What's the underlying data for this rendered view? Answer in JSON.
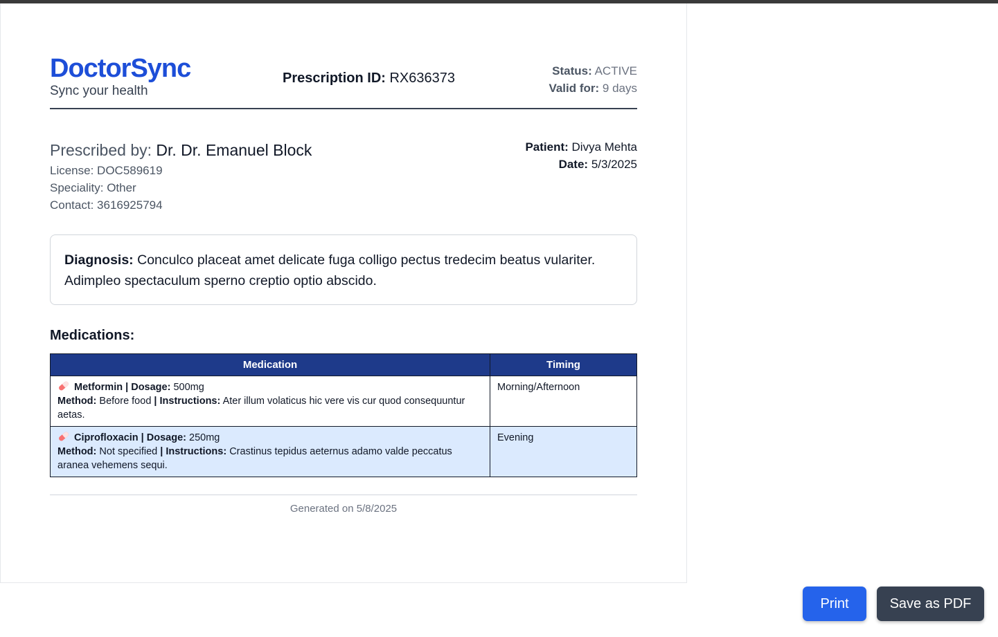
{
  "brand": {
    "name": "DoctorSync",
    "tagline": "Sync your health",
    "color": "#1d4ed8"
  },
  "prescription": {
    "id_label": "Prescription ID:",
    "id": "RX636373",
    "status_label": "Status:",
    "status": "ACTIVE",
    "valid_label": "Valid for:",
    "valid": "9 days"
  },
  "doctor": {
    "prescribed_label": "Prescribed by:",
    "name": "Dr. Dr. Emanuel Block",
    "license": "License: DOC589619",
    "speciality": "Speciality: Other",
    "contact": "Contact: 3616925794"
  },
  "patient": {
    "patient_label": "Patient:",
    "name": "Divya Mehta",
    "date_label": "Date:",
    "date": "5/3/2025"
  },
  "diagnosis": {
    "label": "Diagnosis:",
    "text": "Conculco placeat amet delicate fuga colligo pectus tredecim beatus vulariter. Adimpleo spectaculum sperno creptio optio abscido."
  },
  "medications": {
    "heading": "Medications:",
    "columns": [
      "Medication",
      "Timing"
    ],
    "rows": [
      {
        "icon": "pill-icon",
        "name": "Metformin",
        "sep1": " | ",
        "dosage_label": "Dosage:",
        "dosage": "500mg",
        "method_label": "Method:",
        "method": "Before food",
        "sep2": " | ",
        "instructions_label": "Instructions:",
        "instructions": "Ater illum volaticus hic vere vis cur quod consequuntur aetas.",
        "timing": "Morning/Afternoon"
      },
      {
        "icon": "pill-icon",
        "name": "Ciprofloxacin",
        "sep1": " | ",
        "dosage_label": "Dosage:",
        "dosage": "250mg",
        "method_label": "Method:",
        "method": "Not specified",
        "sep2": " | ",
        "instructions_label": "Instructions:",
        "instructions": "Crastinus tepidus aeternus adamo valde peccatus aranea vehemens sequi.",
        "timing": "Evening"
      }
    ]
  },
  "footer": {
    "generated": "Generated on 5/8/2025"
  },
  "actions": {
    "print": "Print",
    "save_pdf": "Save as PDF"
  },
  "colors": {
    "table_header": "#1e3a8a",
    "row_alt": "#dbeafe",
    "print_button": "#2563eb",
    "pdf_button": "#374151"
  }
}
